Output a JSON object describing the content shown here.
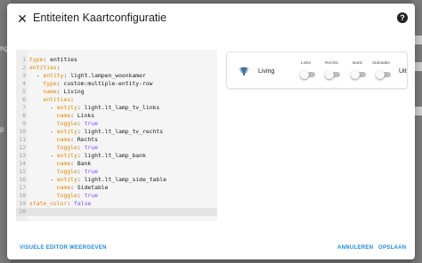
{
  "background": {
    "left_fragments": [
      "ng",
      "p"
    ]
  },
  "dialog": {
    "title": "Entiteiten Kaartconfiguratie",
    "close_icon": "close-icon",
    "help_icon": "help-circle-icon"
  },
  "editor": {
    "lines": [
      {
        "n": "1",
        "indent": "",
        "dash": false,
        "key": "type",
        "sep": ": ",
        "value": "entities"
      },
      {
        "n": "2",
        "indent": "",
        "dash": false,
        "key": "entities",
        "sep": ":",
        "value": ""
      },
      {
        "n": "3",
        "indent": "  ",
        "dash": true,
        "key": "entity",
        "sep": ": ",
        "value": "light.lampen_woonkamer"
      },
      {
        "n": "4",
        "indent": "    ",
        "dash": false,
        "key": "type",
        "sep": ": ",
        "value": "custom:multiple-entity-row"
      },
      {
        "n": "5",
        "indent": "    ",
        "dash": false,
        "key": "name",
        "sep": ": ",
        "value": "Living"
      },
      {
        "n": "6",
        "indent": "    ",
        "dash": false,
        "key": "entities",
        "sep": ":",
        "value": ""
      },
      {
        "n": "7",
        "indent": "      ",
        "dash": true,
        "key": "entity",
        "sep": ": ",
        "value": "light.lt_lamp_tv_links"
      },
      {
        "n": "8",
        "indent": "        ",
        "dash": false,
        "key": "name",
        "sep": ": ",
        "value": "Links"
      },
      {
        "n": "9",
        "indent": "        ",
        "dash": false,
        "key": "toggle",
        "sep": ": ",
        "value": "true",
        "bool": true
      },
      {
        "n": "10",
        "indent": "      ",
        "dash": true,
        "key": "entity",
        "sep": ": ",
        "value": "light.lt_lamp_tv_rechts"
      },
      {
        "n": "11",
        "indent": "        ",
        "dash": false,
        "key": "name",
        "sep": ": ",
        "value": "Rechts"
      },
      {
        "n": "12",
        "indent": "        ",
        "dash": false,
        "key": "toggle",
        "sep": ": ",
        "value": "true",
        "bool": true
      },
      {
        "n": "13",
        "indent": "      ",
        "dash": true,
        "key": "entity",
        "sep": ": ",
        "value": "light.lt_lamp_bank"
      },
      {
        "n": "14",
        "indent": "        ",
        "dash": false,
        "key": "name",
        "sep": ": ",
        "value": "Bank"
      },
      {
        "n": "15",
        "indent": "        ",
        "dash": false,
        "key": "toggle",
        "sep": ": ",
        "value": "true",
        "bool": true
      },
      {
        "n": "16",
        "indent": "      ",
        "dash": true,
        "key": "entity",
        "sep": ": ",
        "value": "light.lt_lamp_side_table"
      },
      {
        "n": "17",
        "indent": "        ",
        "dash": false,
        "key": "name",
        "sep": ": ",
        "value": "Sidetable"
      },
      {
        "n": "18",
        "indent": "        ",
        "dash": false,
        "key": "toggle",
        "sep": ": ",
        "value": "true",
        "bool": true
      },
      {
        "n": "19",
        "indent": "",
        "dash": false,
        "key": "state_color",
        "sep": ": ",
        "value": "false",
        "bool": true
      },
      {
        "n": "20",
        "indent": "",
        "dash": false,
        "key": "",
        "sep": "",
        "value": "",
        "active": true
      }
    ]
  },
  "preview": {
    "icon": "lamp-icon",
    "name": "Living",
    "state": "Uit",
    "toggles": [
      {
        "label": "Links",
        "on": false
      },
      {
        "label": "Rechts",
        "on": false
      },
      {
        "label": "Bank",
        "on": false
      },
      {
        "label": "Sidetable",
        "on": false
      }
    ]
  },
  "footer": {
    "visual_editor": "VISUELE EDITOR WEERGEVEN",
    "cancel": "ANNULEREN",
    "save": "OPSLAAN"
  },
  "colors": {
    "accent": "#1e88e5",
    "yaml_key": "#e08a00",
    "yaml_bool": "#7c4dff",
    "toggle_off": "#bdbdbd"
  }
}
